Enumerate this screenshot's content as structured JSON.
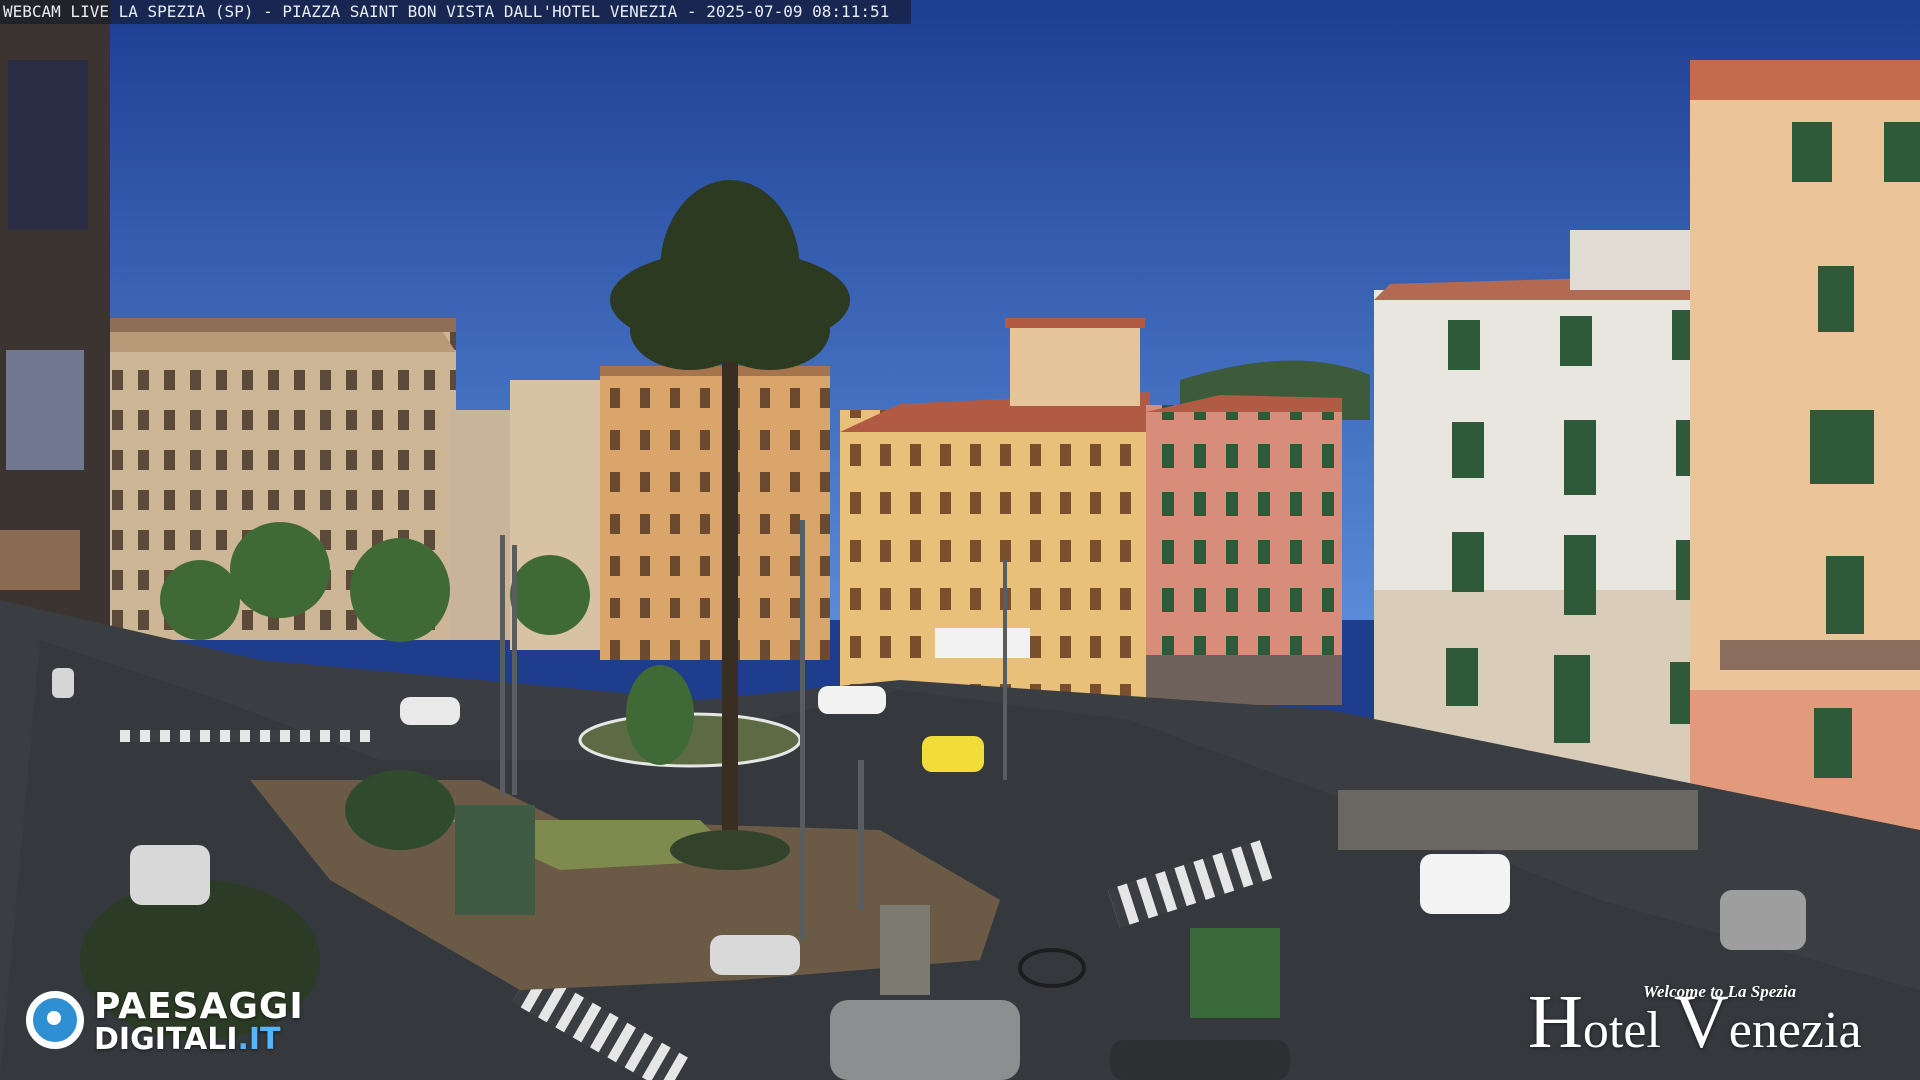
{
  "overlay": {
    "caption": "WEBCAM LIVE LA SPEZIA (SP) - PIAZZA SAINT BON VISTA DALL'HOTEL VENEZIA - 2025-07-09 08:11:51"
  },
  "logo_left": {
    "line1": "PAESAGGI",
    "line2_main": "DIGITALI",
    "line2_ext": ".IT",
    "icon": "eye-logo-icon"
  },
  "logo_right": {
    "tagline_welcome": "Welcome",
    "tagline_to": "to",
    "tagline_city": "La Spezia",
    "hotel_h": "H",
    "hotel_word": "otel",
    "venezia_v": "V",
    "venezia_word": "enezia"
  },
  "colors": {
    "sky_top": "#1d3f93",
    "sky_bottom": "#4f7fd6",
    "road": "#3a3d42",
    "beige_building": "#cdb696",
    "yellow_building": "#e9c07a",
    "pink_building": "#d78a78",
    "white_building": "#e8e6df",
    "salmon_building": "#e9a585",
    "shutter_green": "#2f5a3a",
    "palm": "#2d3a22",
    "tree_green": "#3f6a35",
    "accent_blue": "#52b6ff"
  }
}
